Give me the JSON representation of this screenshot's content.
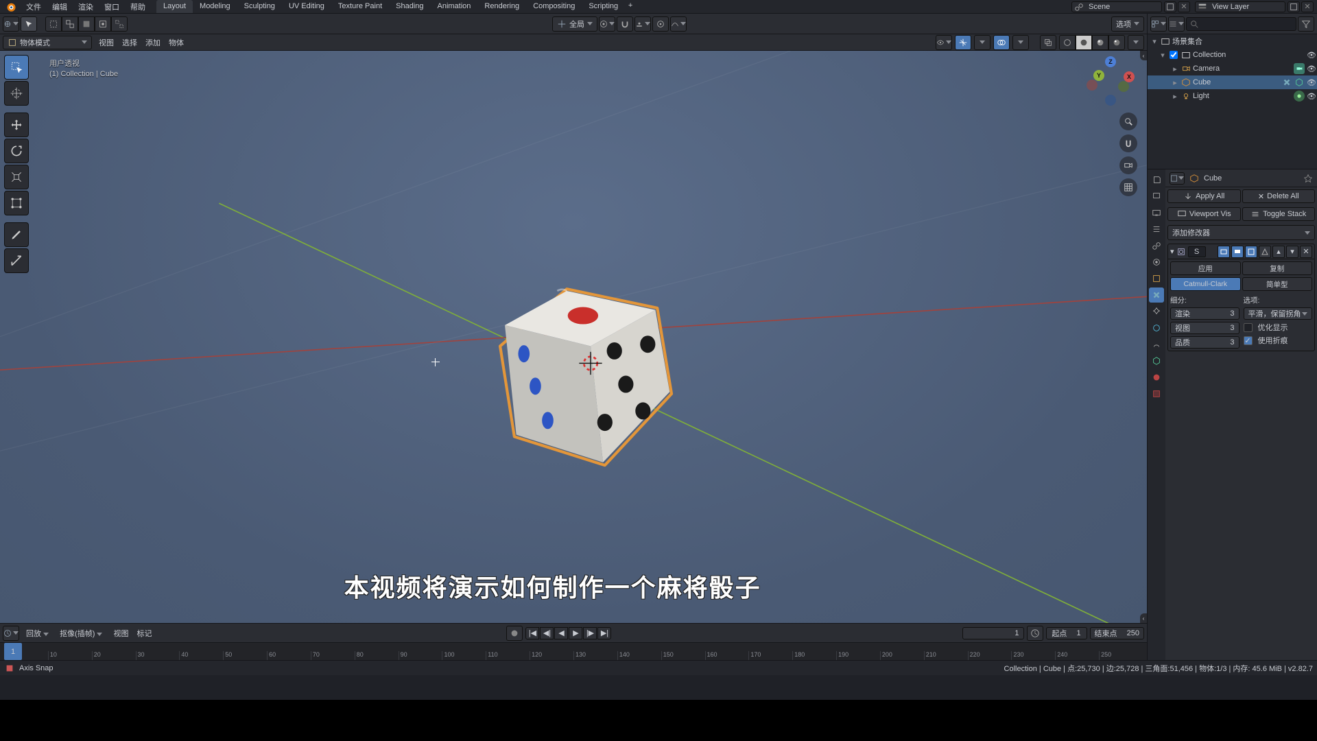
{
  "topbar": {
    "menus": [
      "文件",
      "编辑",
      "渲染",
      "窗口",
      "帮助"
    ],
    "workspaces": [
      "Layout",
      "Modeling",
      "Sculpting",
      "UV Editing",
      "Texture Paint",
      "Shading",
      "Animation",
      "Rendering",
      "Compositing",
      "Scripting"
    ],
    "active_workspace": "Layout",
    "scene_label": "Scene",
    "viewlayer_label": "View Layer"
  },
  "viewport_header": {
    "mode": "物体模式",
    "menus": [
      "视图",
      "选择",
      "添加",
      "物体"
    ],
    "orientation": "全局",
    "options_label": "选项"
  },
  "viewport_overlay": {
    "line1": "用户透视",
    "line2": "(1) Collection | Cube",
    "subtitle": "本视频将演示如何制作一个麻将骰子"
  },
  "gizmo": {
    "x": "X",
    "y": "Y",
    "z": "Z"
  },
  "outliner": {
    "root": "场景集合",
    "items": [
      {
        "name": "Collection",
        "children": [
          {
            "name": "Camera"
          },
          {
            "name": "Cube",
            "selected": true
          },
          {
            "name": "Light"
          }
        ]
      }
    ]
  },
  "properties": {
    "context": "Cube",
    "buttons": {
      "apply_all": "Apply All",
      "delete_all": "Delete All",
      "viewport_vis": "Viewport Vis",
      "toggle_stack": "Toggle Stack"
    },
    "add_modifier": "添加修改器",
    "modifier": {
      "name": "S",
      "apply": "应用",
      "copy": "复制",
      "type_active": "Catmull-Clark",
      "type_other": "简单型",
      "subdiv_label": "细分:",
      "options_label": "选项:",
      "render_label": "渲染",
      "render_value": "3",
      "viewport_label": "视图",
      "viewport_value": "3",
      "quality_label": "品质",
      "quality_value": "3",
      "uv_smooth_label": "平滑，保留拐角",
      "opt_optimal": "优化显示",
      "opt_crease": "使用折痕"
    }
  },
  "timeline": {
    "playback": "回放",
    "keying": "抠像(插帧)",
    "menus": [
      "视图",
      "标记"
    ],
    "current": "1",
    "start_label": "起点",
    "start": "1",
    "end_label": "结束点",
    "end": "250",
    "ticks": [
      "10",
      "20",
      "30",
      "40",
      "50",
      "60",
      "70",
      "80",
      "90",
      "100",
      "110",
      "120",
      "130",
      "140",
      "150",
      "160",
      "170",
      "180",
      "190",
      "200",
      "210",
      "220",
      "230",
      "240",
      "250"
    ]
  },
  "footer": {
    "left": "Axis Snap",
    "right": "Collection | Cube | 点:25,730 | 边:25,728 | 三角面:51,456 | 物体:1/3 | 内存: 45.6 MiB | v2.82.7"
  },
  "colors": {
    "accent": "#4b7ab6"
  }
}
